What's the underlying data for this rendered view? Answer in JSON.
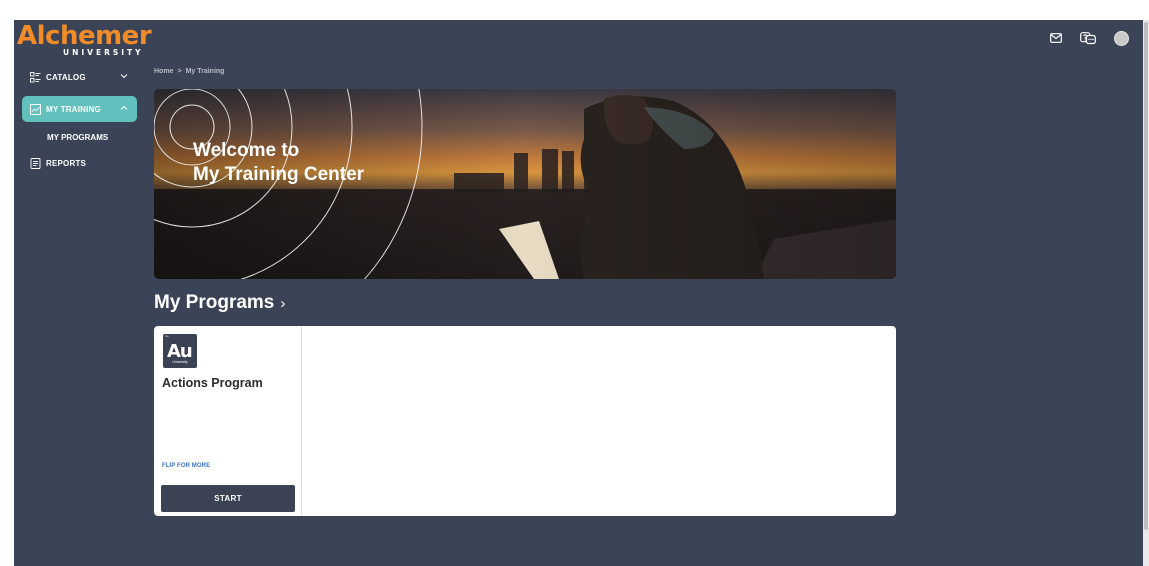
{
  "brand": {
    "name": "Alchemer",
    "subtitle": "UNIVERSITY",
    "accent": "#f28c28"
  },
  "header": {
    "icons": [
      "mail-icon",
      "help-chat-icon",
      "avatar"
    ]
  },
  "sidebar": {
    "items": [
      {
        "label": "CATALOG",
        "icon": "catalog-icon",
        "expanded": false
      },
      {
        "label": "MY TRAINING",
        "icon": "trending-icon",
        "expanded": true,
        "active": true
      },
      {
        "label": "MY PROGRAMS"
      },
      {
        "label": "REPORTS",
        "icon": "reports-icon"
      }
    ],
    "active_color": "#62c0bd"
  },
  "breadcrumb": {
    "home": "Home",
    "separator": ">",
    "current": "My Training"
  },
  "hero": {
    "line1": "Welcome to",
    "line2": "My Training Center"
  },
  "programs": {
    "title": "My Programs",
    "chevron": "›",
    "cards": [
      {
        "logo_text": "Au",
        "logo_caption": "University",
        "logo_tm": "™",
        "title": "Actions Program",
        "flip_label": "FLIP FOR MORE",
        "start_label": "START"
      }
    ]
  },
  "colors": {
    "background": "#3b4456",
    "button": "#3a4253",
    "link": "#3a73c6"
  }
}
